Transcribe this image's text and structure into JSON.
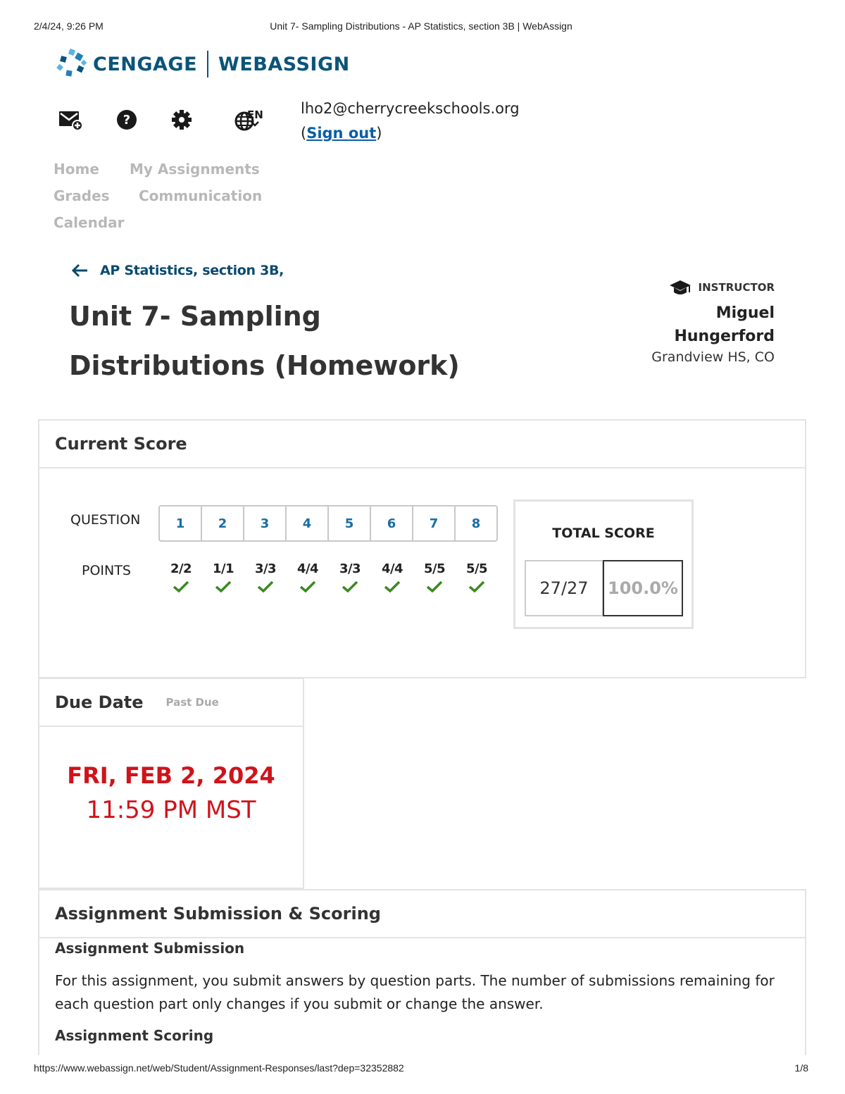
{
  "print_header": {
    "datetime": "2/4/24, 9:26 PM",
    "title": "Unit 7- Sampling Distributions - AP Statistics, section 3B | WebAssign"
  },
  "logo": {
    "brand": "CENGAGE",
    "product": "WEBASSIGN"
  },
  "toolbar": {
    "icons": [
      "message-icon",
      "help-icon",
      "settings-gear-icon",
      "globe-language-icon"
    ],
    "language": "EN"
  },
  "user": {
    "email": "lho2@cherrycreekschools.org",
    "open_paren": "(",
    "sign_out": "Sign out",
    "close_paren": ")"
  },
  "nav": {
    "home": "Home",
    "my_assignments": "My Assignments",
    "grades": "Grades",
    "communication": "Communication",
    "calendar": "Calendar"
  },
  "breadcrumb": {
    "course": "AP Statistics, section 3B,"
  },
  "assignment": {
    "title": "Unit 7- Sampling Distributions (Homework)"
  },
  "instructor": {
    "role": "INSTRUCTOR",
    "name_first": "Miguel",
    "name_last": "Hungerford",
    "school": "Grandview HS, CO"
  },
  "current_score": {
    "heading": "Current Score",
    "question_label": "QUESTION",
    "points_label": "POINTS",
    "questions": [
      "1",
      "2",
      "3",
      "4",
      "5",
      "6",
      "7",
      "8"
    ],
    "points": [
      "2/2",
      "1/1",
      "3/3",
      "4/4",
      "3/3",
      "4/4",
      "5/5",
      "5/5"
    ],
    "total_label": "TOTAL SCORE",
    "total_points": "27/27",
    "total_percent": "100.0%"
  },
  "due_date": {
    "heading": "Due Date",
    "status": "Past Due",
    "date": "FRI, FEB 2, 2024",
    "time": "11:59 PM MST"
  },
  "submission": {
    "heading": "Assignment Submission & Scoring",
    "submission_heading": "Assignment Submission",
    "submission_text": "For this assignment, you submit answers by question parts. The number of submissions remaining for each question part only changes if you submit or change the answer.",
    "scoring_heading": "Assignment Scoring"
  },
  "print_footer": {
    "url": "https://www.webassign.net/web/Student/Assignment-Responses/last?dep=32352882",
    "page": "1/8"
  },
  "colors": {
    "brand_blue": "#0a5479",
    "link_blue": "#1a6da6",
    "due_red": "#d0131b",
    "check_green": "#3a8a1f",
    "nav_gray": "#b8b8b8"
  }
}
